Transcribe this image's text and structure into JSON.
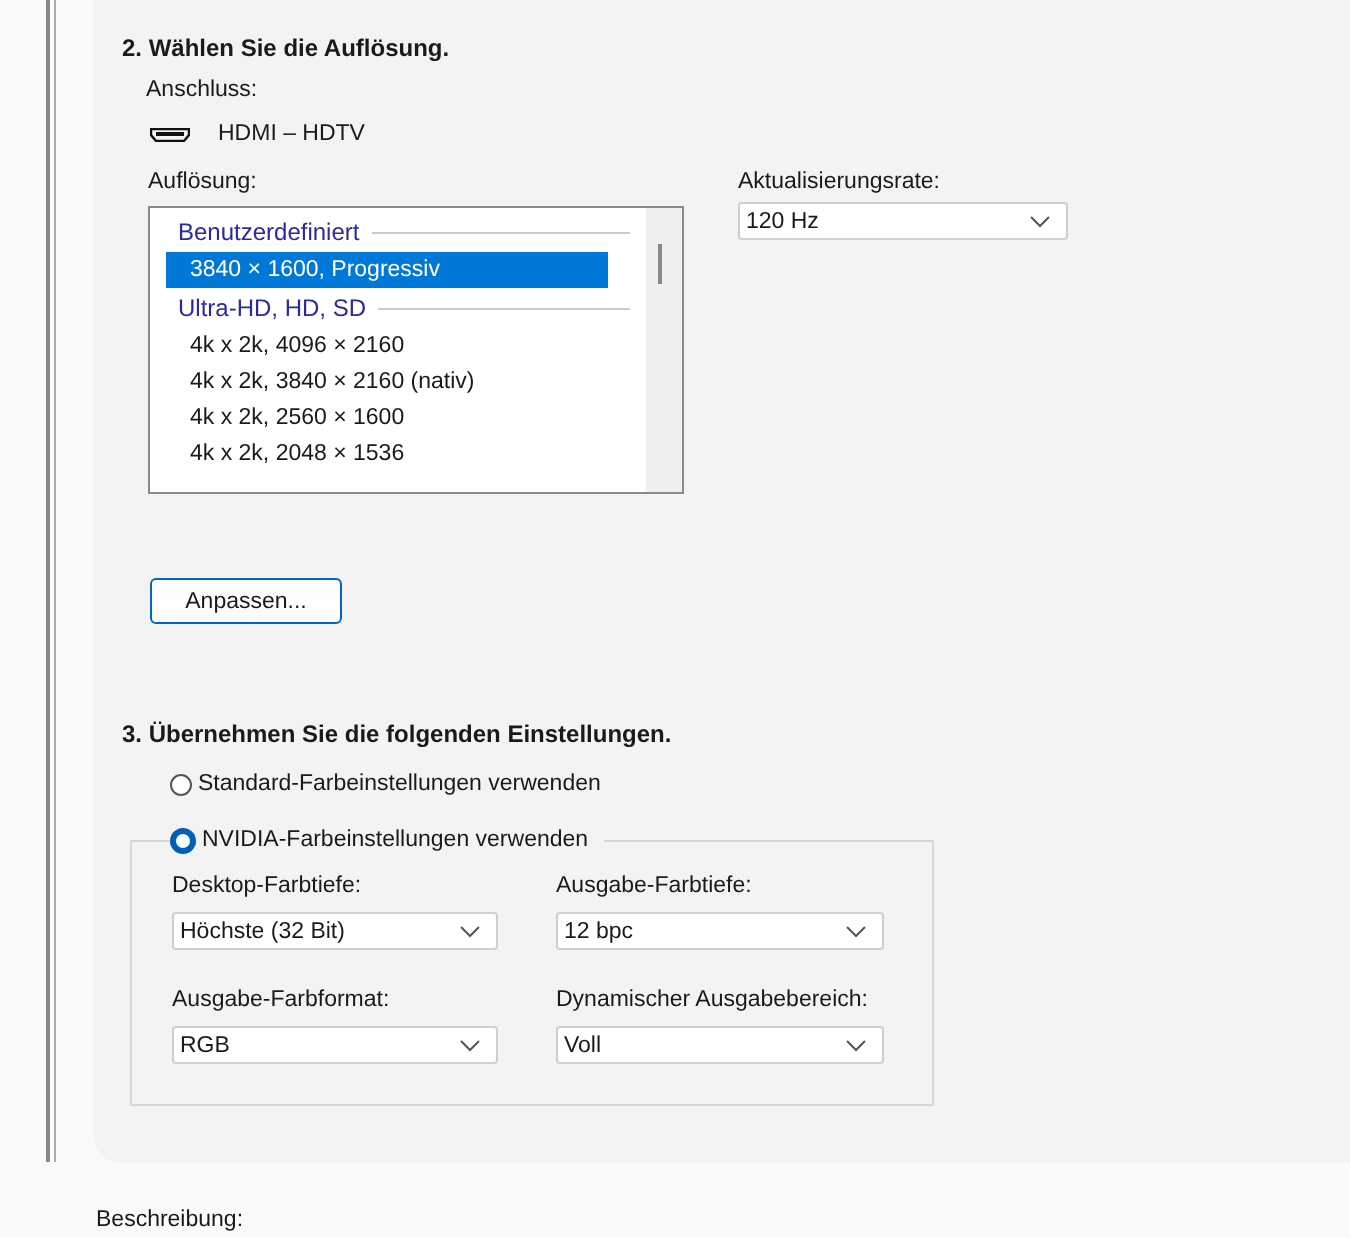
{
  "section_2": {
    "heading": "2. Wählen Sie die Auflösung.",
    "connector_label": "Anschluss:",
    "connector": "HDMI – HDTV",
    "resolution_label": "Auflösung:",
    "resolutions": [
      {
        "kind": "group",
        "text": "Benutzerdefiniert"
      },
      {
        "kind": "option",
        "text": "3840 × 1600, Progressiv",
        "selected": true
      },
      {
        "kind": "group",
        "text": "Ultra-HD, HD, SD"
      },
      {
        "kind": "option",
        "text": "4k x 2k, 4096 × 2160",
        "selected": false
      },
      {
        "kind": "option",
        "text": "4k x 2k, 3840 × 2160 (nativ)",
        "selected": false
      },
      {
        "kind": "option",
        "text": "4k x 2k, 2560 × 1600",
        "selected": false
      },
      {
        "kind": "option",
        "text": "4k x 2k, 2048 × 1536",
        "selected": false
      }
    ],
    "refresh_label": "Aktualisierungsrate:",
    "refresh_value": "120 Hz",
    "customize_button": "Anpassen..."
  },
  "section_3": {
    "heading": "3. Übernehmen Sie die folgenden Einstellungen.",
    "options": [
      {
        "label": "Standard-Farbeinstellungen verwenden",
        "selected": false
      },
      {
        "label": "NVIDIA-Farbeinstellungen verwenden",
        "selected": true
      }
    ],
    "fields": [
      {
        "label": "Desktop-Farbtiefe:",
        "value": "Höchste (32 Bit)"
      },
      {
        "label": "Ausgabe-Farbtiefe:",
        "value": "12 bpc"
      },
      {
        "label": "Ausgabe-Farbformat:",
        "value": "RGB"
      },
      {
        "label": "Dynamischer Ausgabebereich:",
        "value": "Voll"
      }
    ]
  },
  "description_label": "Beschreibung:"
}
